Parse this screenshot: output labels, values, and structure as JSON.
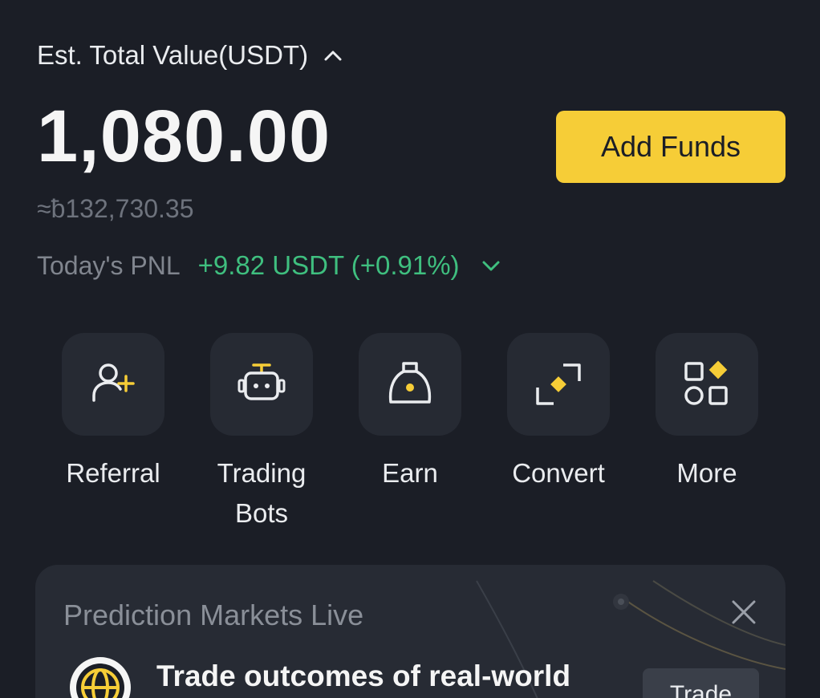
{
  "balance": {
    "label": "Est. Total Value(USDT)",
    "total": "1,080.00",
    "approx": "≈ƀ132,730.35",
    "add_funds_label": "Add Funds"
  },
  "pnl": {
    "label": "Today's PNL",
    "value": "+9.82 USDT (+0.91%)"
  },
  "actions": [
    {
      "label": "Referral",
      "icon": "add-user-icon"
    },
    {
      "label": "Trading Bots",
      "icon": "robot-icon"
    },
    {
      "label": "Earn",
      "icon": "money-bag-icon"
    },
    {
      "label": "Convert",
      "icon": "convert-icon"
    },
    {
      "label": "More",
      "icon": "grid-icon"
    }
  ],
  "promo": {
    "title": "Prediction Markets Live",
    "headline": "Trade outcomes of real-world",
    "button_label": "Trade"
  },
  "colors": {
    "background": "#1b1e26",
    "accent": "#f6cd37",
    "positive": "#3fbf7f",
    "tile": "#262a33"
  }
}
